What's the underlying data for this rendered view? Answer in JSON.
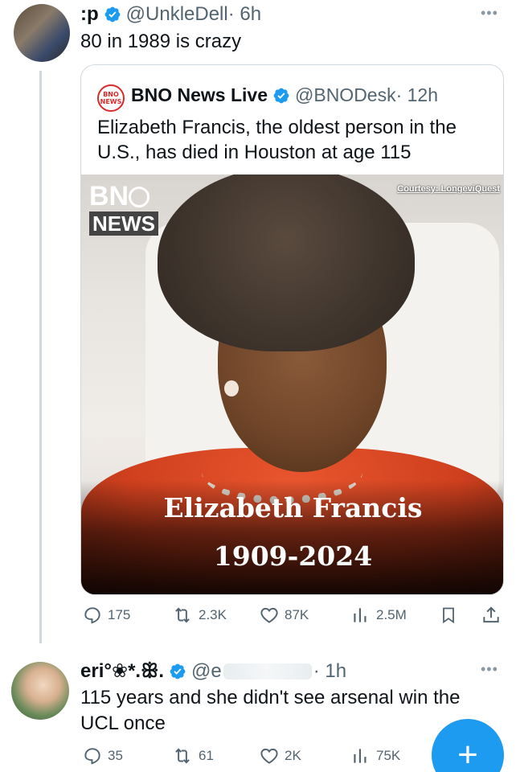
{
  "colors": {
    "accent": "#1d9bf0",
    "text": "#0f1419",
    "muted": "#536471",
    "bno_red": "#d92a2a"
  },
  "post1": {
    "name": ":p",
    "handle": "@UnkleDell",
    "time": "· 6h",
    "text": "80 in 1989 is crazy",
    "more_icon": "more-dots-icon",
    "stats": {
      "replies": "175",
      "reposts": "2.3K",
      "likes": "87K",
      "views": "2.5M"
    }
  },
  "quote": {
    "logo_top": "BNO",
    "logo_bottom": "NEWS",
    "name": "BNO News Live",
    "handle": "@BNODesk",
    "time": "· 12h",
    "text": "Elizabeth Francis, the oldest person in the U.S., has died in Houston at age 115",
    "image": {
      "watermark_top": "BN",
      "watermark_bottom": "NEWS",
      "courtesy": "Courtesy: LongeviQuest",
      "caption_name": "Elizabeth Francis",
      "caption_years": "1909-2024"
    }
  },
  "post2": {
    "name": "eri°❀*.ꕥ.",
    "handle": "@e",
    "time": "· 1h",
    "text": "115 years and she didn't see arsenal win the UCL once",
    "stats": {
      "replies": "35",
      "reposts": "61",
      "likes": "2K",
      "views": "75K"
    }
  },
  "fab": {
    "label": "+"
  }
}
